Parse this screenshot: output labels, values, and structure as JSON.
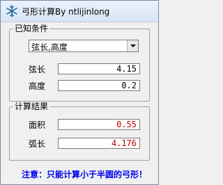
{
  "window": {
    "title": "弓形计算By ntlijinlong"
  },
  "known_group": {
    "legend": "已知条件",
    "mode_select": {
      "value": "弦长,高度"
    },
    "chord": {
      "label": "弦长",
      "value": "4.15"
    },
    "height": {
      "label": "高度",
      "value": "0.2"
    }
  },
  "result_group": {
    "legend": "计算结果",
    "area": {
      "label": "面积",
      "value": "0.55"
    },
    "arc_length": {
      "label": "弧长",
      "value": "4.176"
    }
  },
  "notice": "注意：只能计算小于半圆的弓形！",
  "colors": {
    "result_text": "#c00000",
    "notice_text": "#0000ee"
  }
}
